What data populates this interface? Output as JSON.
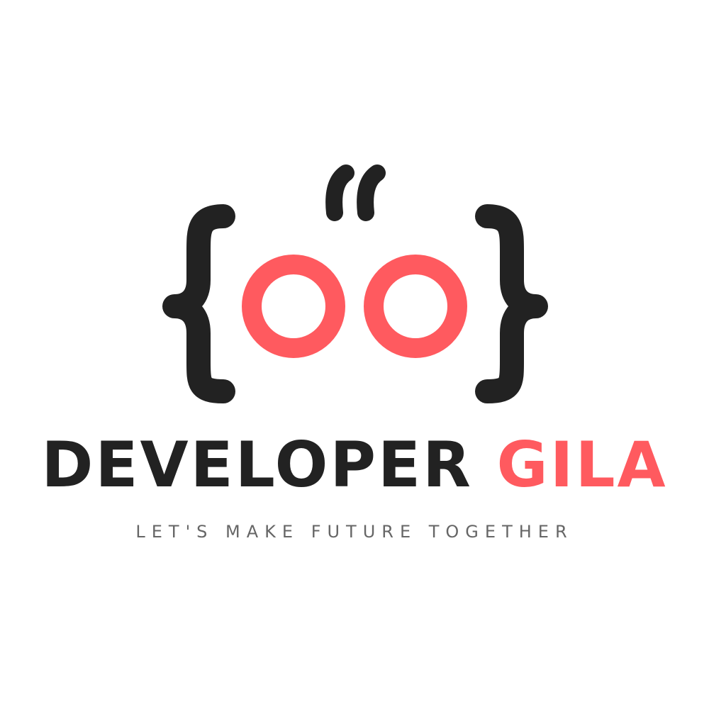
{
  "logo": {
    "icon_name": "curly-braces-eyes-quote-mark",
    "colors": {
      "dark": "#222222",
      "accent": "#ff5a5f",
      "background": "#ffffff",
      "tagline": "#666666"
    },
    "name_part_1": "DEVELOPER",
    "name_part_2": "GILA",
    "tagline": "LET'S MAKE FUTURE TOGETHER"
  }
}
